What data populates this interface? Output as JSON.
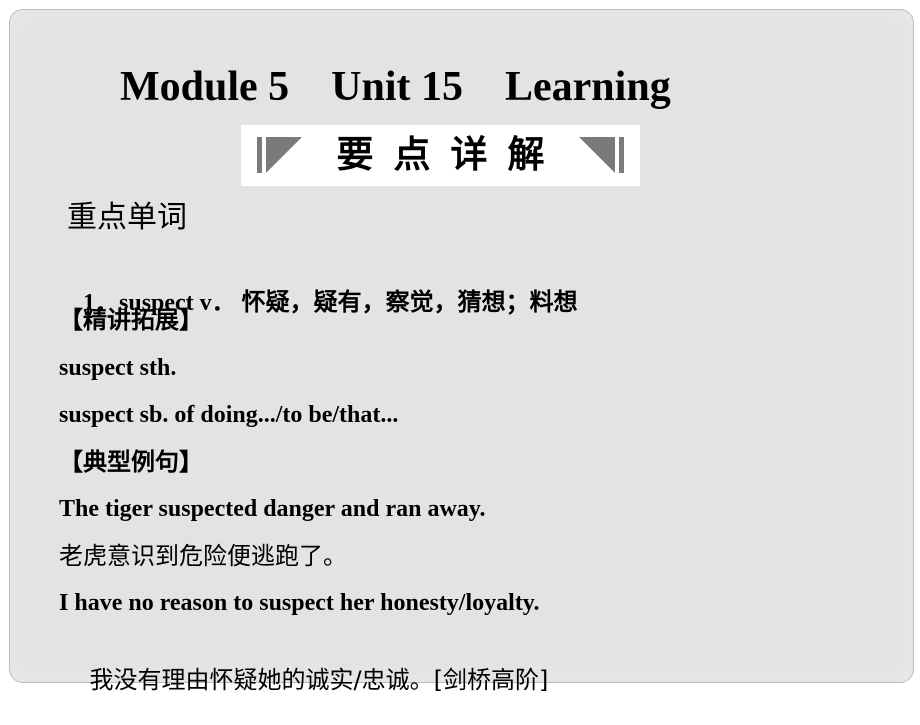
{
  "title": "Module 5    Unit 15    Learning",
  "banner": {
    "text": "要点详解",
    "left_icon": "triangle-bar-left-icon",
    "right_icon": "triangle-bar-right-icon",
    "accent_color": "#7a7a7a"
  },
  "section_heading": "重点单词",
  "entry": {
    "number": "1．",
    "word": "suspect v．",
    "gloss": "怀疑，疑有，察觉，猜想；料想"
  },
  "expansion": {
    "label": "【精讲拓展】",
    "items": [
      "suspect sth.",
      "suspect sb. of doing.../to be/that..."
    ]
  },
  "examples": {
    "label": "【典型例句】",
    "items": [
      {
        "en": "The tiger suspected danger and ran away.",
        "zh": "老虎意识到危险便逃跑了。",
        "source": ""
      },
      {
        "en": "I have no reason to suspect her honesty/loyalty.",
        "zh": "我没有理由怀疑她的诚实/忠诚。",
        "source": "[剑桥高阶]"
      }
    ]
  },
  "colors": {
    "slide_background": "#e3e3e3",
    "text": "#000000",
    "banner_background": "#ffffff"
  }
}
